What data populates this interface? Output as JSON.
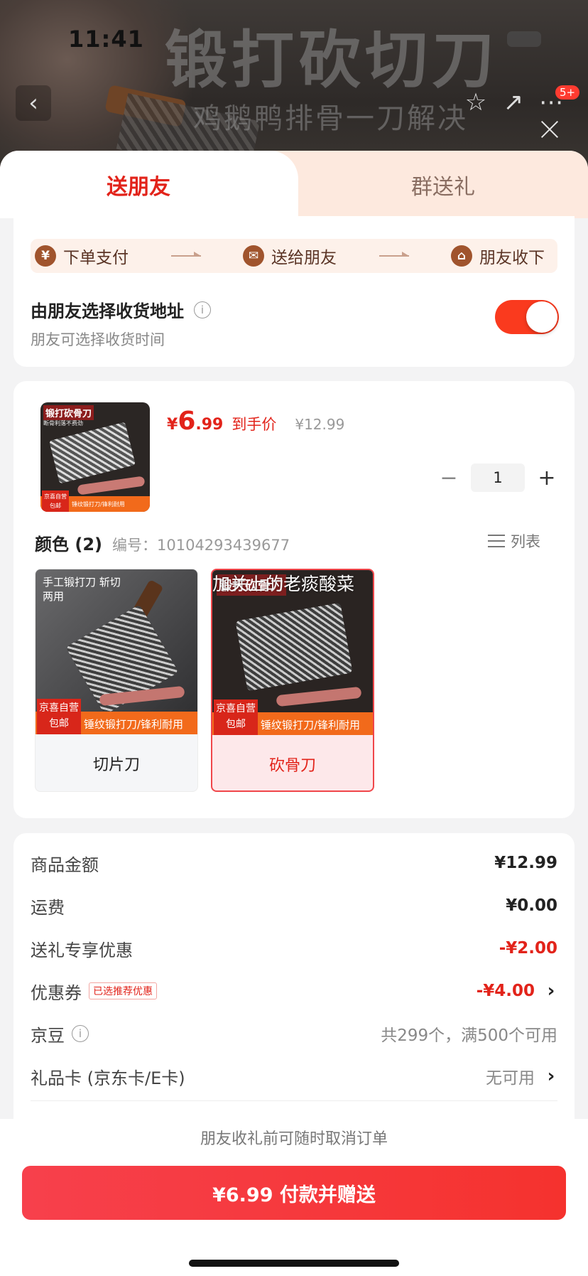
{
  "status_bar": {
    "time": "11:41"
  },
  "ad": {
    "title": "锻打砍切刀",
    "subtitle": "鸡鹅鸭排骨一刀解决"
  },
  "nav": {
    "badge": "5+"
  },
  "tabs": [
    {
      "label": "送朋友",
      "active": true
    },
    {
      "label": "群送礼",
      "active": false
    }
  ],
  "steps": [
    {
      "icon": "yen-icon",
      "glyph": "¥",
      "label": "下单支付"
    },
    {
      "icon": "wechat-icon",
      "glyph": "✉",
      "label": "送给朋友"
    },
    {
      "icon": "gift-icon",
      "glyph": "⌂",
      "label": "朋友收下"
    }
  ],
  "address": {
    "title": "由朋友选择收货地址",
    "subtitle": "朋友可选择收货时间",
    "toggle_on": true
  },
  "product": {
    "thumb_title": "锻打砍骨刀",
    "thumb_sub": "断骨利落不费劲",
    "thumb_tag": "京喜自营 包邮",
    "thumb_band": "锤纹锻打刀/锋利耐用",
    "price_symbol": "¥",
    "price_int": "6",
    "price_dec": ".99",
    "price_label": "到手价",
    "orig_price": "¥12.99",
    "qty": "1"
  },
  "spec": {
    "title": "颜色 (2)",
    "id": "编号：10104293439677",
    "list_label": "列表",
    "overlay_text": "加关上的老痰酸菜",
    "variants": [
      {
        "name": "切片刀",
        "img_title": "手工锻打刀 斩切两用",
        "band": "锤纹锻打刀/锋利耐用",
        "tag_line1": "京喜自营",
        "tag_line2": "包邮",
        "selected": false
      },
      {
        "name": "砍骨刀",
        "img_title": "锻打砍骨刀",
        "band": "锤纹锻打刀/锋利耐用",
        "tag_line1": "京喜自营",
        "tag_line2": "包邮",
        "selected": true
      }
    ]
  },
  "fees": [
    {
      "label": "商品金额",
      "value": "¥12.99",
      "style": "normal"
    },
    {
      "label": "运费",
      "value": "¥0.00",
      "style": "normal"
    },
    {
      "label": "送礼专享优惠",
      "value": "-¥2.00",
      "style": "red"
    },
    {
      "label": "优惠券",
      "tag": "已选推荐优惠",
      "value": "-¥4.00",
      "style": "red",
      "chevron": true
    },
    {
      "label": "京豆",
      "value": "共299个，满500个可用",
      "style": "gray",
      "info": true
    },
    {
      "label": "礼品卡 (京东卡/E卡)",
      "value": "无可用",
      "style": "gray",
      "chevron": true
    }
  ],
  "bottom": {
    "note": "朋友收礼前可随时取消订单",
    "pay_label": "¥6.99 付款并赠送"
  },
  "colors": {
    "accent": "#e2231a",
    "toggle": "#fa3a1e",
    "pay_start": "#f7404c",
    "pay_end": "#f5322e"
  }
}
